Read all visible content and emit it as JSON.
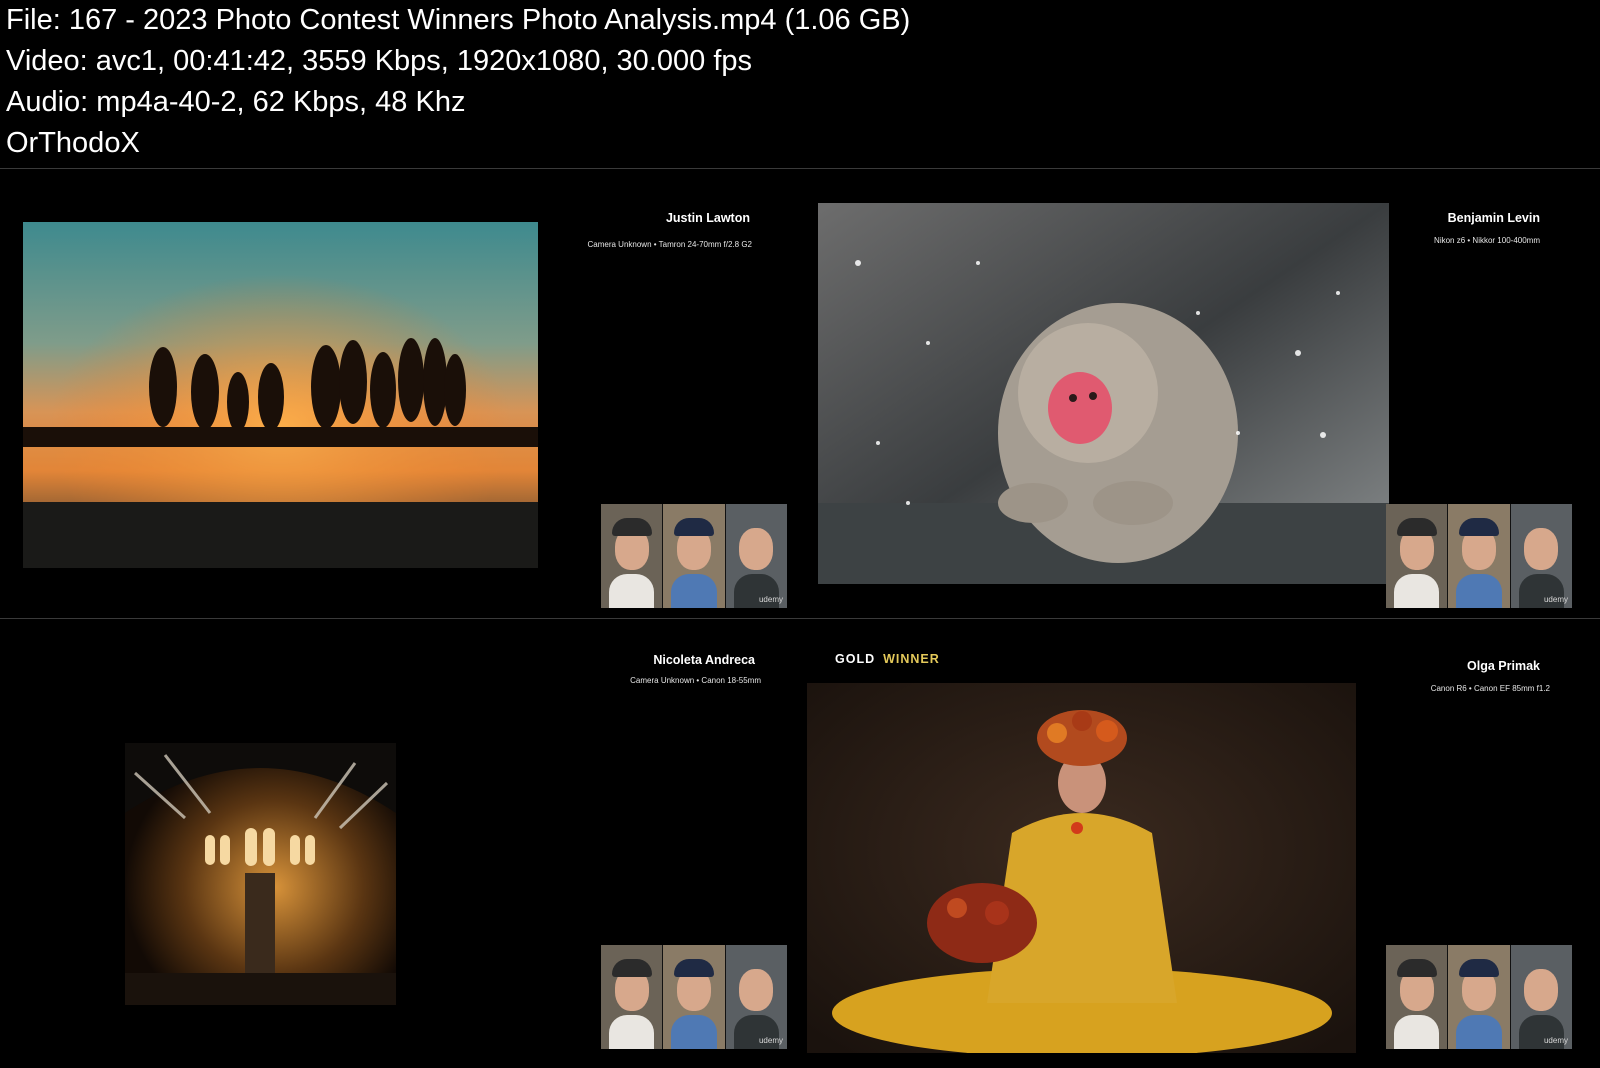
{
  "header": {
    "file_line": "File: 167 - 2023 Photo Contest Winners Photo Analysis.mp4 (1.06 GB)",
    "video_line": "Video: avc1, 00:41:42, 3559 Kbps, 1920x1080, 30.000 fps",
    "audio_line": "Audio: mp4a-40-2, 62 Kbps, 48 Khz",
    "credit_line": "OrThodoX"
  },
  "frames": [
    {
      "photographer": "Justin Lawton",
      "gear": "Camera Unknown • Tamron 24-70mm f/2.8 G2",
      "photo_icon": "sunrise-trees-photo",
      "webcam_brand": "udemy"
    },
    {
      "photographer": "Benjamin Levin",
      "gear": "Nikon z6 • Nikkor 100-400mm",
      "photo_icon": "snow-monkey-photo",
      "webcam_brand": "udemy"
    },
    {
      "photographer": "Nicoleta Andreca",
      "gear": "Camera Unknown • Canon 18-55mm",
      "photo_icon": "cathedral-hall-photo",
      "webcam_brand": "udemy"
    },
    {
      "award_prefix": "GOLD",
      "award_suffix": "WINNER",
      "photographer": "Olga Primak",
      "gear": "Canon R6 • Canon EF 85mm f1.2",
      "photo_icon": "woman-yellow-dress-photo",
      "webcam_brand": "udemy"
    }
  ],
  "colors": {
    "background": "#000000",
    "award_gold": "#e4c95a"
  }
}
